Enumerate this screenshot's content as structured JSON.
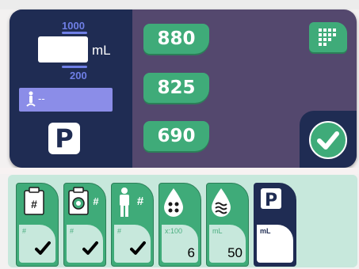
{
  "volume": {
    "max_label": "1000",
    "min_label": "200",
    "current_value": "",
    "unit": "mL"
  },
  "patient": {
    "value": "--"
  },
  "presets": [
    "880",
    "825",
    "690"
  ],
  "parking": {
    "label": "P"
  },
  "cards": [
    {
      "id": "clipboard",
      "top": "#",
      "sub": "#",
      "value": "",
      "checked": true
    },
    {
      "id": "camera",
      "top": "#",
      "sub": "#",
      "value": "",
      "checked": true
    },
    {
      "id": "person",
      "top": "#",
      "sub": "#",
      "value": "",
      "checked": true
    },
    {
      "id": "drops",
      "top": "",
      "sub": "x:100",
      "value": "6",
      "checked": false
    },
    {
      "id": "waves",
      "top": "",
      "sub": "mL",
      "value": "50",
      "checked": false
    },
    {
      "id": "park",
      "top": "P",
      "sub": "mL",
      "value": "",
      "checked": false
    }
  ],
  "colors": {
    "panel_dark": "#1f2c53",
    "panel_purple": "#54486e",
    "accent_green": "#3fab79",
    "accent_blue": "#6f7fe6",
    "tray": "#c7e8dc"
  }
}
